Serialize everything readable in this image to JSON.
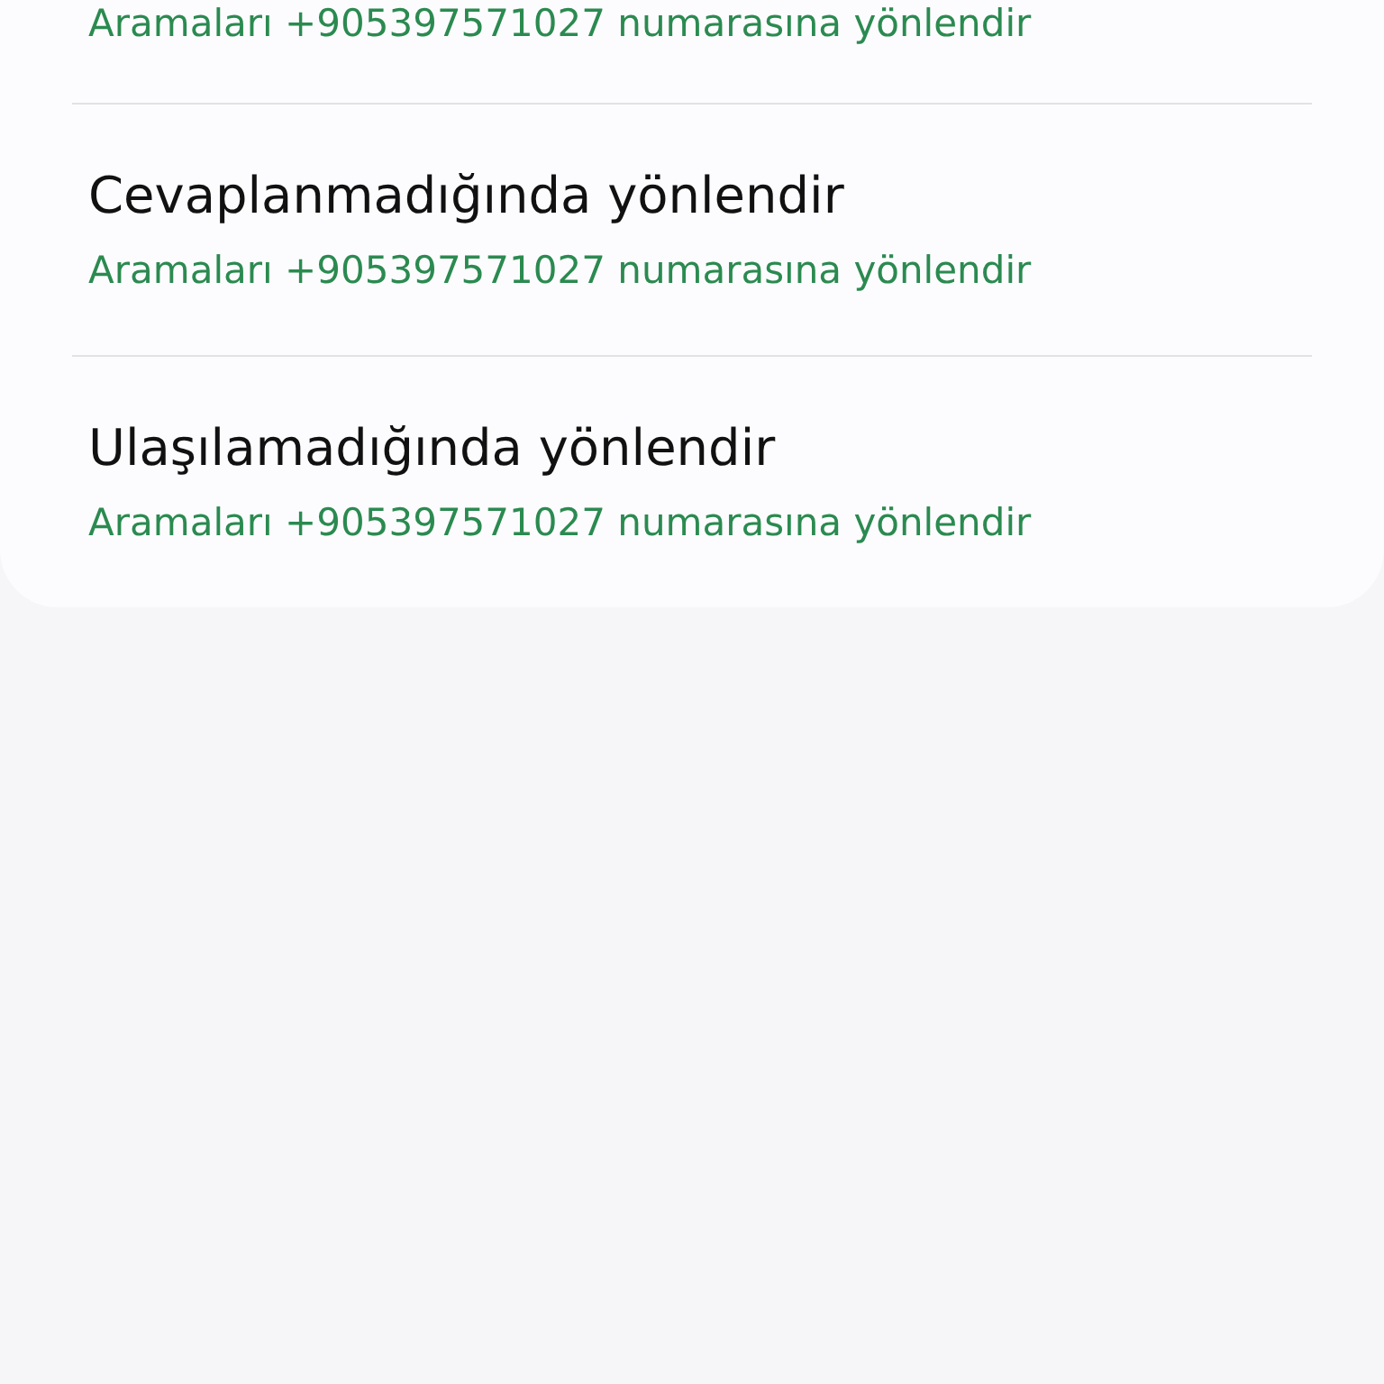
{
  "forwarding_options": [
    {
      "subtitle": "Aramaları +905397571027 numarasına yönlendir"
    },
    {
      "title": "Cevaplanmadığında yönlendir",
      "subtitle": "Aramaları +905397571027 numarasına yönlendir"
    },
    {
      "title": "Ulaşılamadığında yönlendir",
      "subtitle": "Aramaları +905397571027 numarasına yönlendir"
    }
  ]
}
